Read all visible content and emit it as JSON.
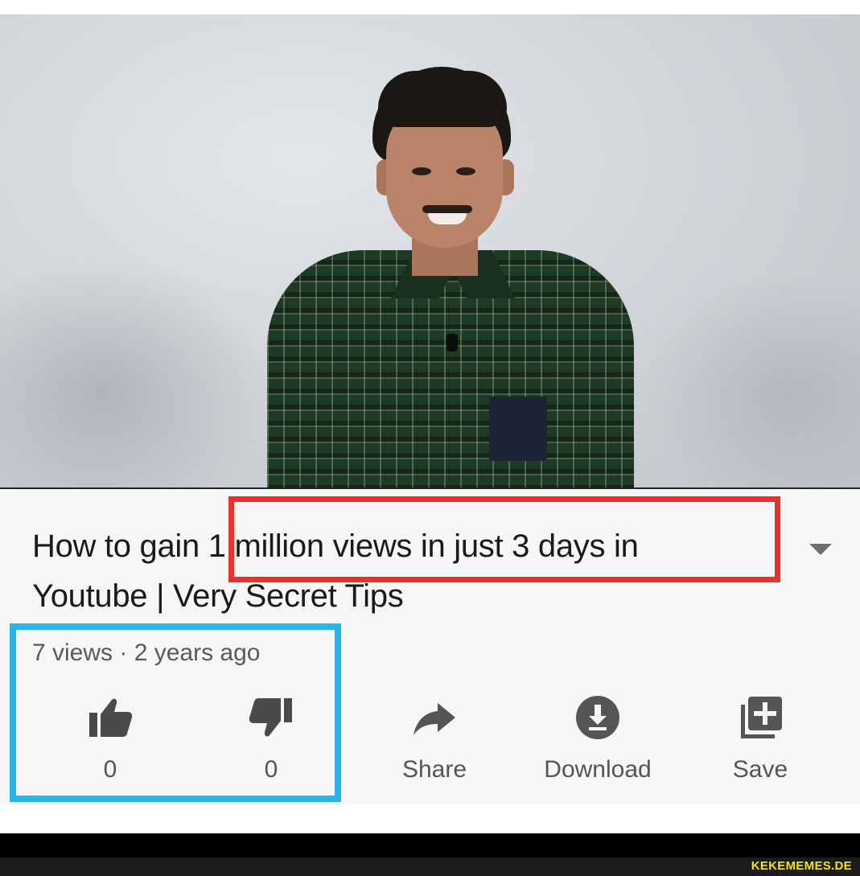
{
  "video": {
    "title_line1_a": "How to gain",
    "title_line1_b": "1 million views in just 3 days in",
    "title_line2": "Youtube | Very Secret Tips",
    "meta": "7 views · 2 years ago"
  },
  "actions": {
    "like_count": "0",
    "dislike_count": "0",
    "share_label": "Share",
    "download_label": "Download",
    "save_label": "Save"
  },
  "watermark": "KEKEMEMES.DE",
  "colors": {
    "highlight_red": "#e8322d",
    "highlight_blue": "#2ab4e8",
    "watermark_yellow": "#f5e21a"
  },
  "icons": {
    "expand": "chevron-down-icon",
    "like": "thumbs-up-icon",
    "dislike": "thumbs-down-icon",
    "share": "share-arrow-icon",
    "download": "download-icon",
    "save": "add-to-playlist-icon"
  }
}
